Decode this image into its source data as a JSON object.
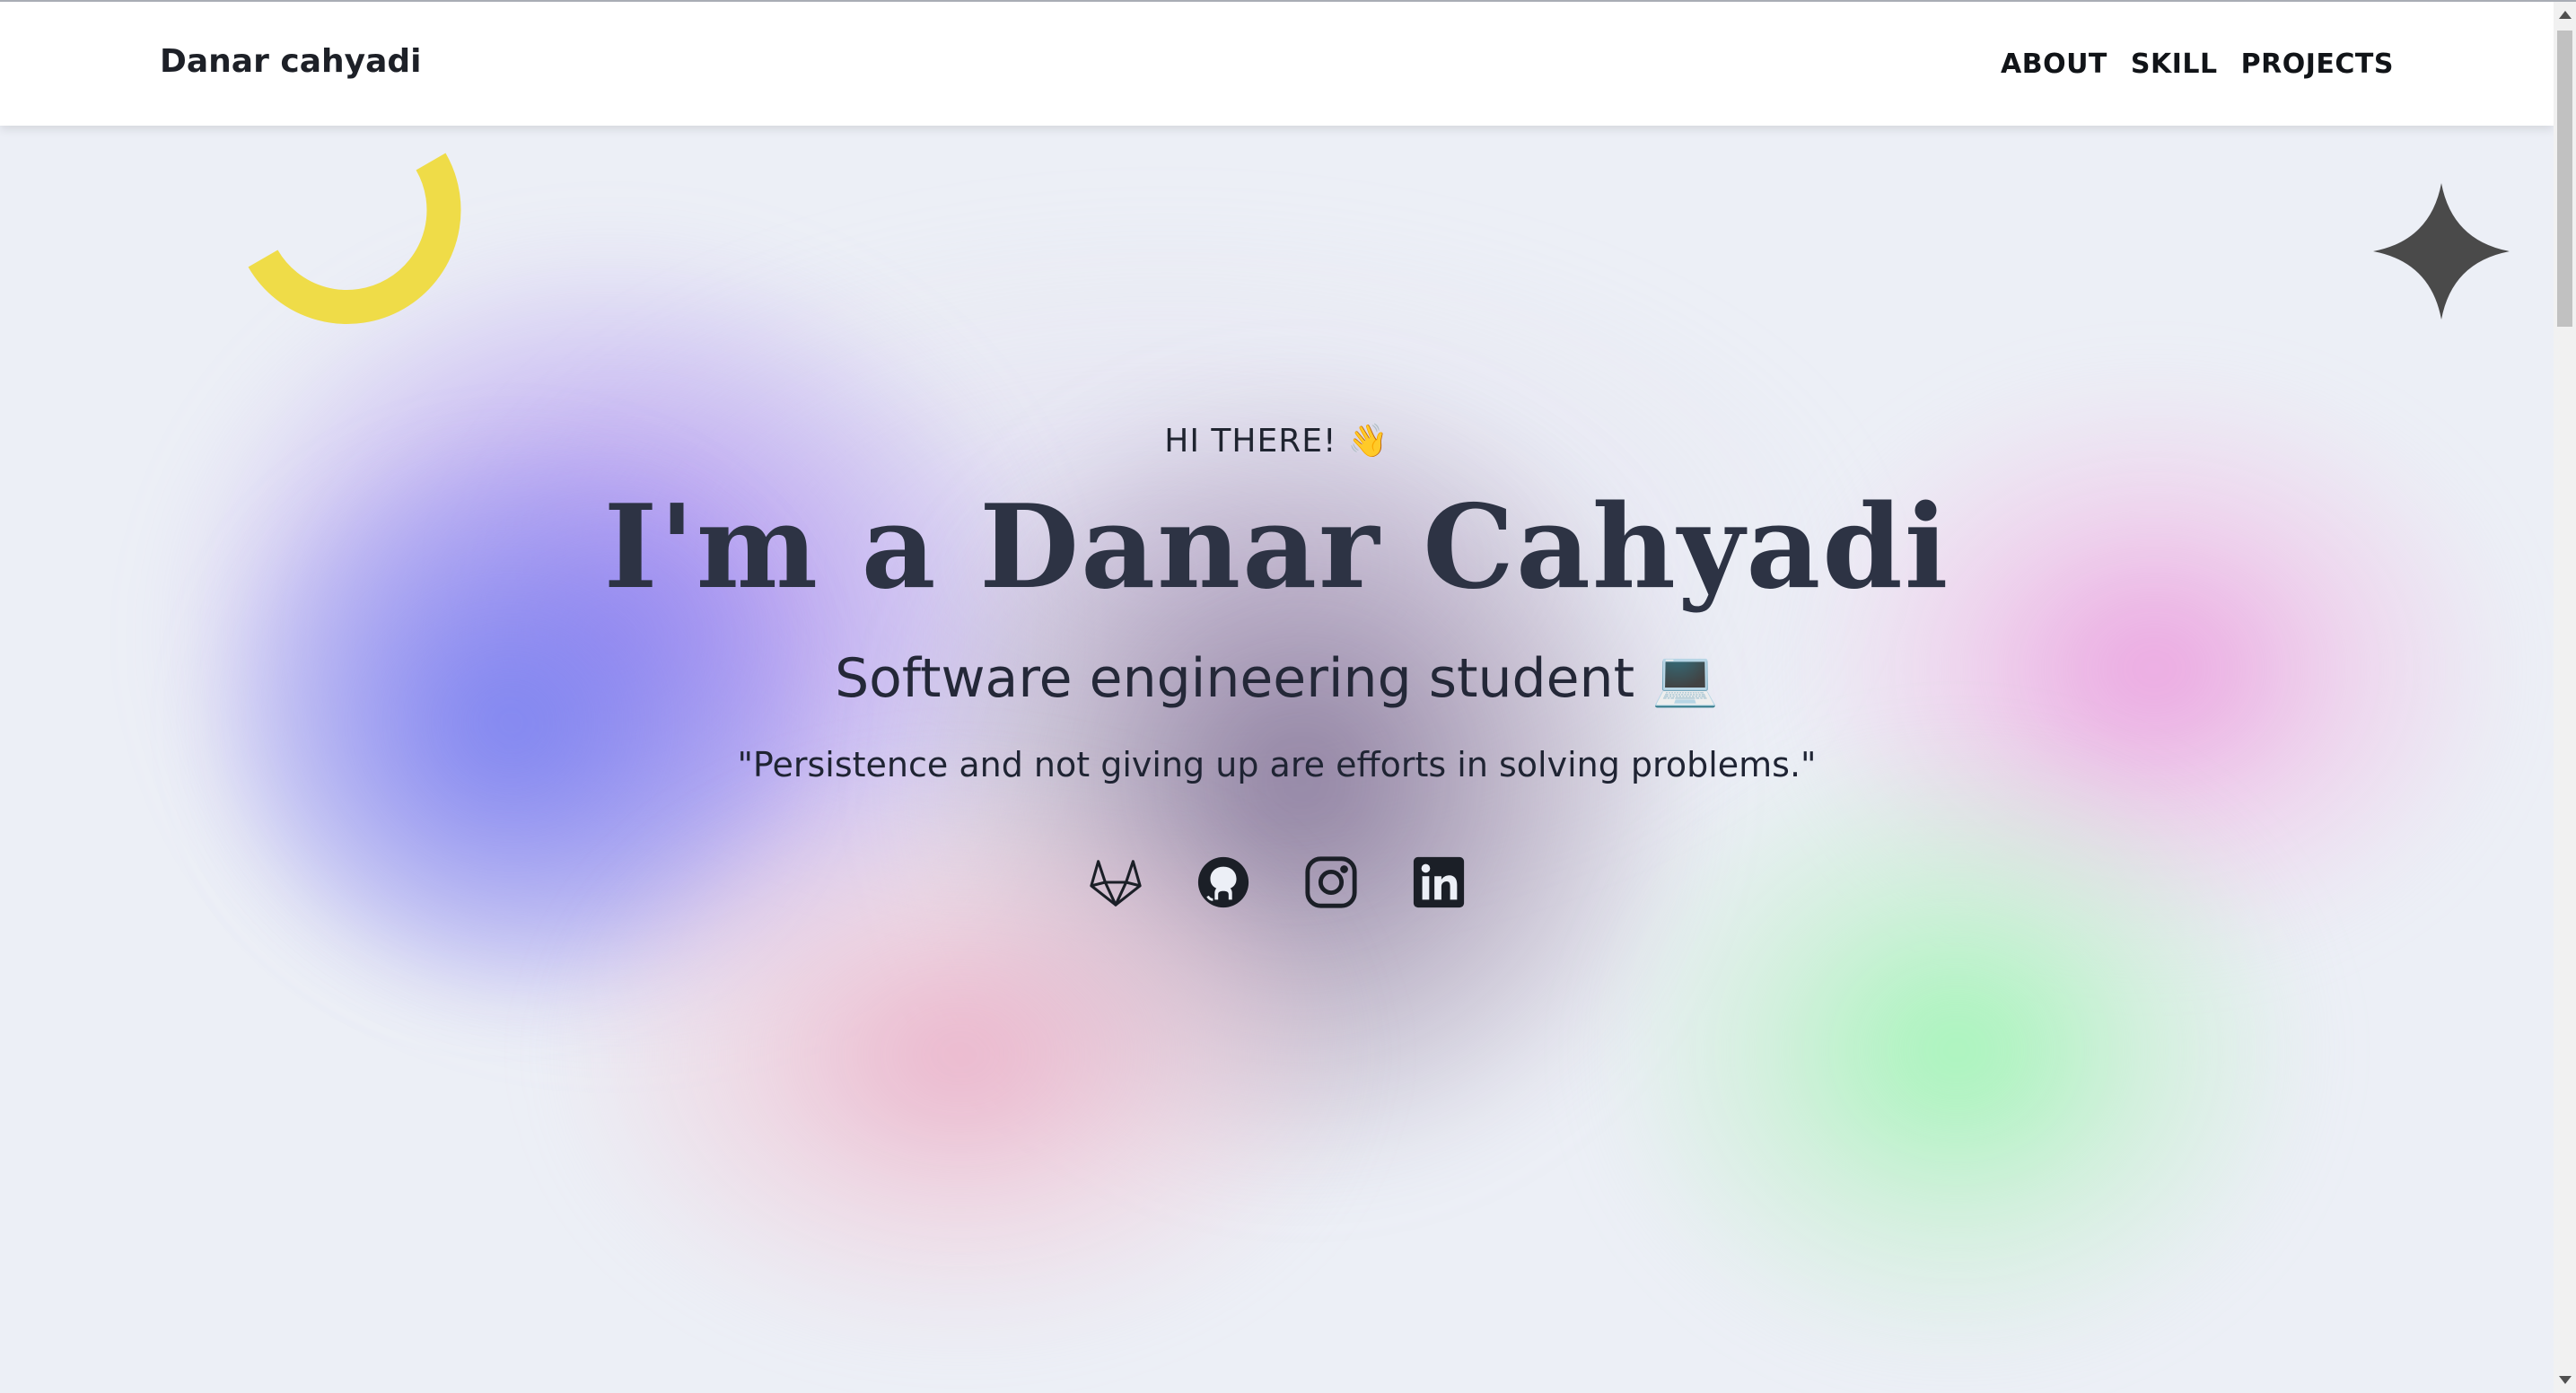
{
  "nav": {
    "brand": "Danar cahyadi",
    "links": [
      "ABOUT",
      "SKILL",
      "PROJECTS"
    ]
  },
  "hero": {
    "greeting": "HI THERE! 👋",
    "title": "I'm a Danar Cahyadi",
    "subtitle": "Software engineering student 💻",
    "quote": "\"Persistence and not giving up are efforts in solving problems.\""
  },
  "socials": [
    "gitlab-icon",
    "github-icon",
    "instagram-icon",
    "linkedin-icon"
  ],
  "decorations": [
    "ring-arc",
    "four-point-star"
  ],
  "colors": {
    "background": "#eceff6",
    "text": "#2d3344",
    "ring": "#efdc48",
    "star": "#4a4a4a"
  }
}
